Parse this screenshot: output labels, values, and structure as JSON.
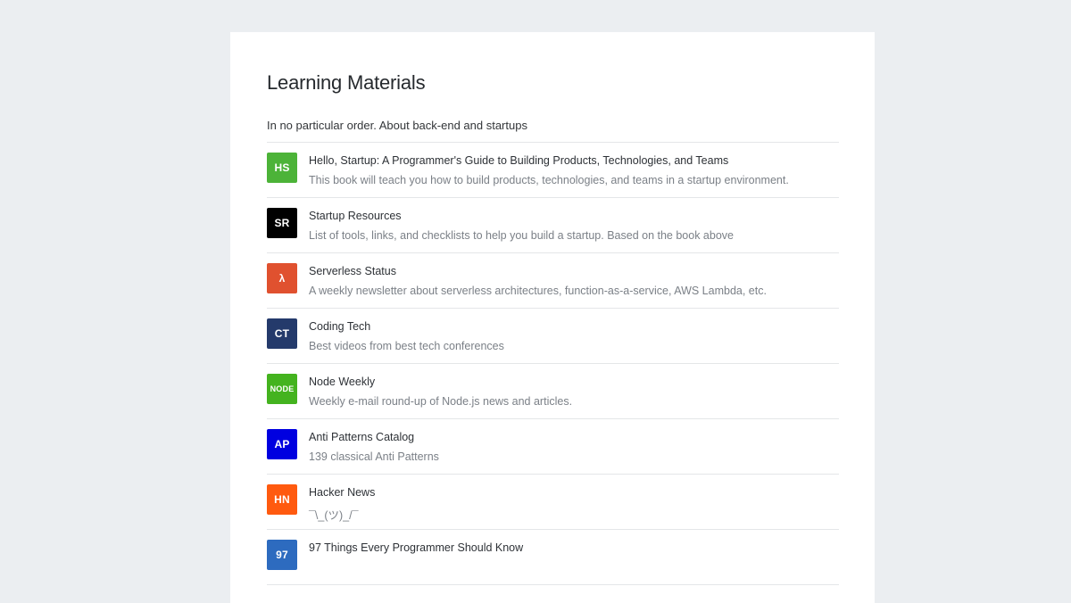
{
  "page": {
    "title": "Learning Materials",
    "subtitle": "In no particular order. About back-end and startups"
  },
  "items": [
    {
      "logo": "HS",
      "color": "#4cb338",
      "title": "Hello, Startup: A Programmer's Guide to Building Products, Technologies, and Teams",
      "description": "This book will teach you how to build products, technologies, and teams in a startup environment."
    },
    {
      "logo": "SR",
      "color": "#000000",
      "title": "Startup Resources",
      "description": "List of tools, links, and checklists to help you build a startup. Based on the book above"
    },
    {
      "logo": "λ",
      "color": "#e0512f",
      "title": "Serverless Status",
      "description": "A weekly newsletter about serverless architectures, function-as-a-service, AWS Lambda, etc."
    },
    {
      "logo": "CT",
      "color": "#243a6b",
      "title": "Coding Tech",
      "description": "Best videos from best tech conferences"
    },
    {
      "logo": "NODE",
      "color": "#44b31f",
      "title": "Node Weekly",
      "description": "Weekly e-mail round-up of Node.js news and articles."
    },
    {
      "logo": "AP",
      "color": "#0000e0",
      "title": "Anti Patterns Catalog",
      "description": "139 classical Anti Patterns"
    },
    {
      "logo": "HN",
      "color": "#ff5a0f",
      "title": "Hacker News",
      "description": "¯\\_(ツ)_/¯"
    },
    {
      "logo": "97",
      "color": "#2d6bbf",
      "title": "97 Things Every Programmer Should Know",
      "description": ""
    }
  ]
}
